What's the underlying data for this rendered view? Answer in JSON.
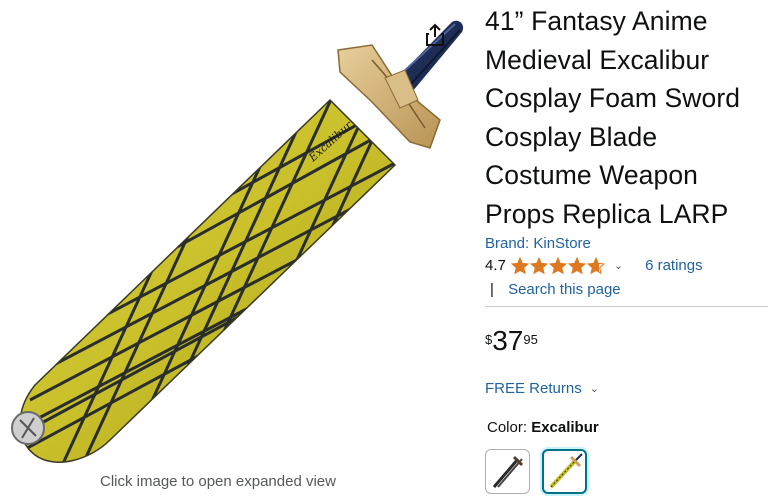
{
  "product": {
    "title": "41” Fantasy Anime Medieval Excalibur Cosplay Foam Sword Cosplay Blade Costume Weapon Props Replica LARP",
    "brand": "Brand: KinStore",
    "rating": "4.7",
    "rating_stars": 4.7,
    "ratings_count": "6 ratings",
    "search_link": "Search this page",
    "price": {
      "symbol": "$",
      "whole": "37",
      "fraction": "95"
    },
    "returns": "FREE Returns",
    "color_label": "Color:",
    "color_value": "Excalibur"
  },
  "image": {
    "caption": "Click image to open expanded view",
    "share_icon": "share-icon",
    "blade_text": "Excalibur"
  },
  "colors": {
    "accent": "#2162a1",
    "star": "#de7921",
    "selected_border": "#007185"
  }
}
